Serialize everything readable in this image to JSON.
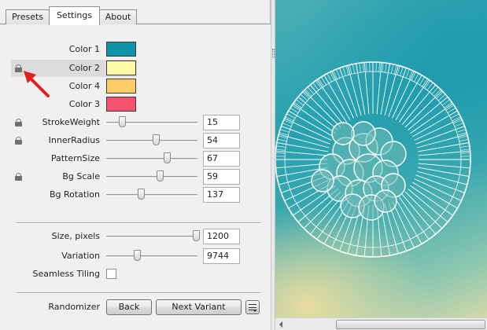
{
  "tabs": {
    "presets": "Presets",
    "settings": "Settings",
    "about": "About"
  },
  "colors": [
    {
      "label": "Color 1",
      "value": "#0f93a6",
      "locked": false
    },
    {
      "label": "Color 2",
      "value": "#fffaa8",
      "locked": true
    },
    {
      "label": "Color 4",
      "value": "#ffcc66",
      "locked": false
    },
    {
      "label": "Color 3",
      "value": "#f5526e",
      "locked": false
    }
  ],
  "params": [
    {
      "label": "StrokeWeight",
      "value": "15",
      "slider": 0.17,
      "locked": true
    },
    {
      "label": "InnerRadius",
      "value": "54",
      "slider": 0.54,
      "locked": true
    },
    {
      "label": "PatternSize",
      "value": "67",
      "slider": 0.66,
      "locked": false
    },
    {
      "label": "Bg Scale",
      "value": "59",
      "slider": 0.59,
      "locked": true
    },
    {
      "label": "Bg Rotation",
      "value": "137",
      "slider": 0.38,
      "locked": false
    }
  ],
  "output": [
    {
      "label": "Size, pixels",
      "value": "1200",
      "slider": 0.98
    },
    {
      "label": "Variation",
      "value": "9744",
      "slider": 0.34
    }
  ],
  "seamless": {
    "label": "Seamless Tiling",
    "checked": false
  },
  "randomizer": {
    "label": "Randomizer",
    "back": "Back",
    "next": "Next Variant"
  },
  "annotation_color": "#e02020"
}
